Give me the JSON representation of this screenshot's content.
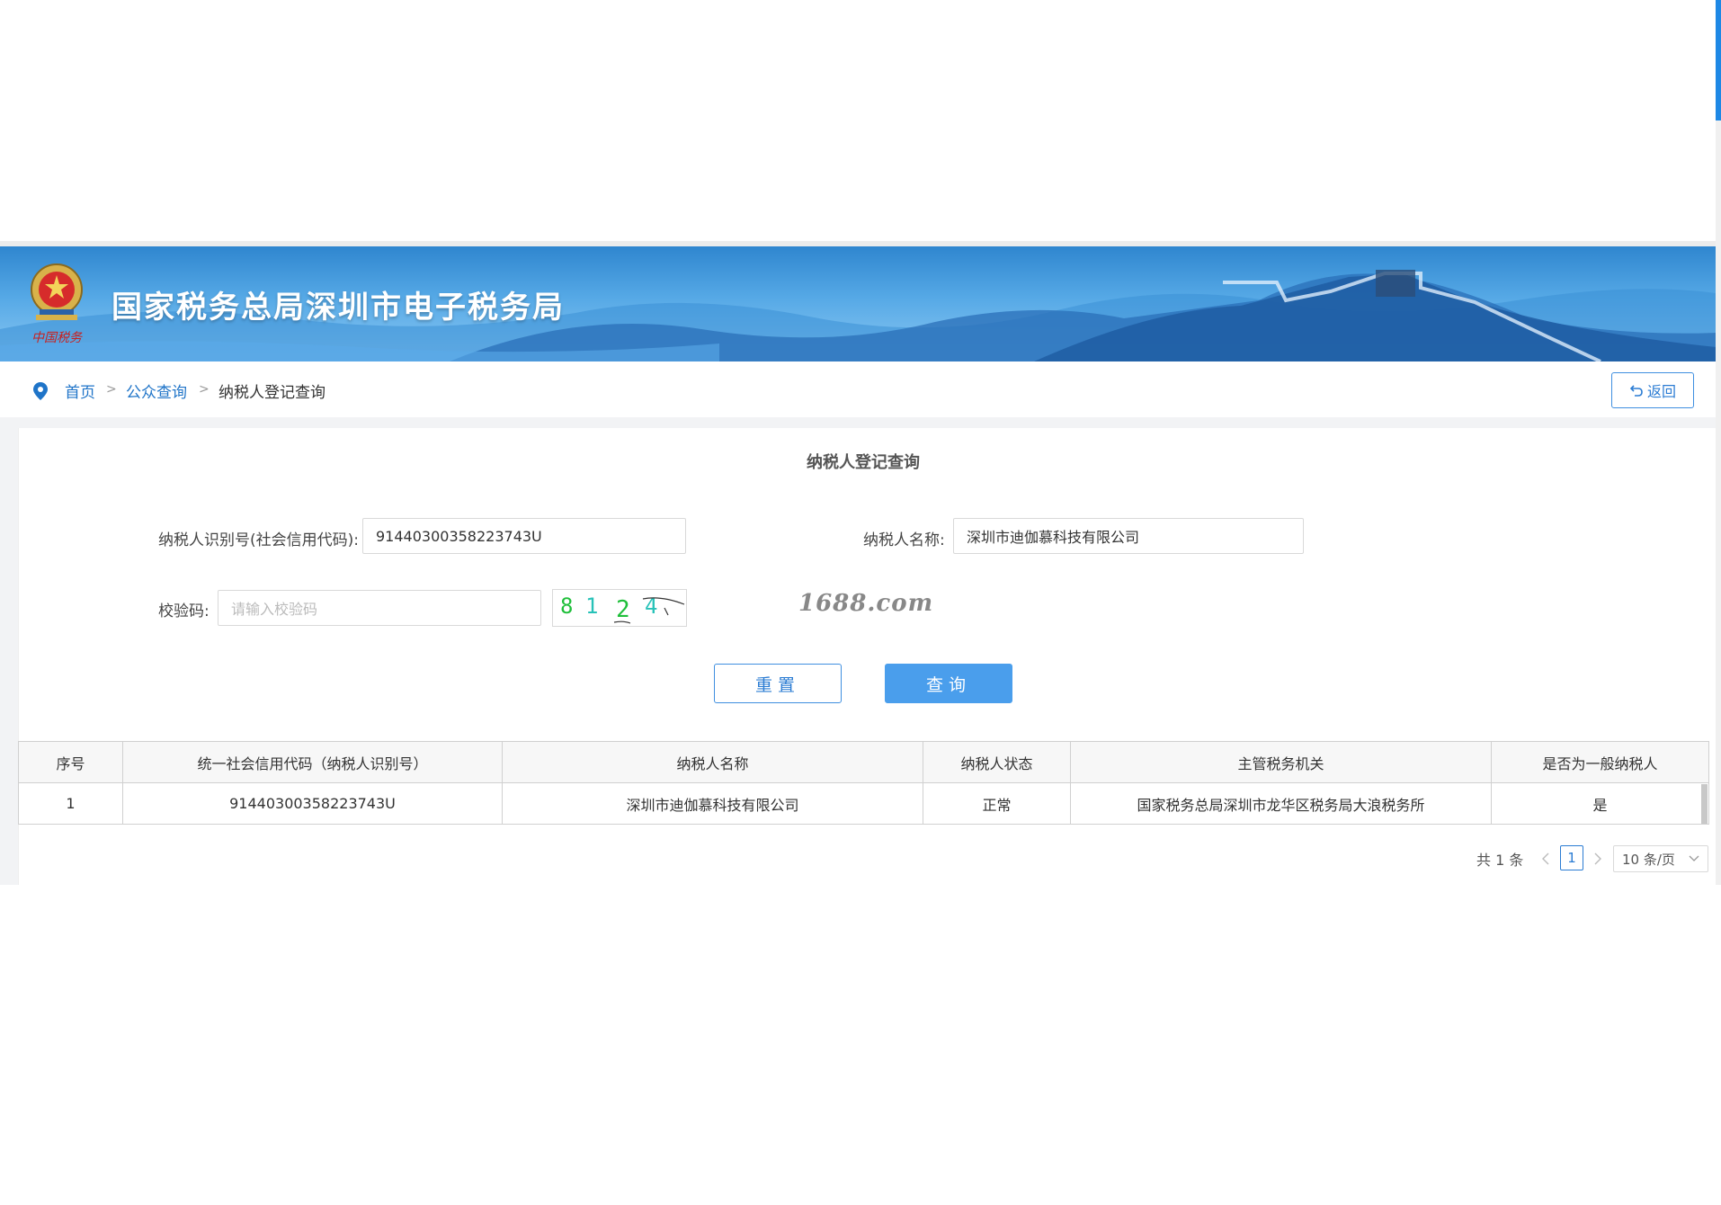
{
  "header": {
    "title": "国家税务总局深圳市电子税务局",
    "emblem_caption": "中国税务"
  },
  "breadcrumb": {
    "items": [
      "首页",
      "公众查询",
      "纳税人登记查询"
    ],
    "separator": ">",
    "back_label": "返回"
  },
  "form": {
    "title": "纳税人登记查询",
    "taxpayer_id_label": "纳税人识别号(社会信用代码):",
    "taxpayer_id_value": "91440300358223743U",
    "taxpayer_name_label": "纳税人名称:",
    "taxpayer_name_value": "深圳市迪伽慕科技有限公司",
    "captcha_label": "校验码:",
    "captcha_placeholder": "请输入校验码",
    "captcha_image_text": "8124",
    "reset_label": "重置",
    "query_label": "查询"
  },
  "watermark": "1688.com",
  "table": {
    "columns": [
      "序号",
      "统一社会信用代码（纳税人识别号）",
      "纳税人名称",
      "纳税人状态",
      "主管税务机关",
      "是否为一般纳税人"
    ],
    "rows": [
      [
        "1",
        "91440300358223743U",
        "深圳市迪伽慕科技有限公司",
        "正常",
        "国家税务总局深圳市龙华区税务局大浪税务所",
        "是"
      ]
    ]
  },
  "pagination": {
    "total_label": "共 1 条",
    "current_page": "1",
    "page_size_label": "10 条/页"
  },
  "colors": {
    "accent": "#2b7cd3",
    "query_button": "#4a9eec",
    "banner_top": "#2f86cf"
  }
}
